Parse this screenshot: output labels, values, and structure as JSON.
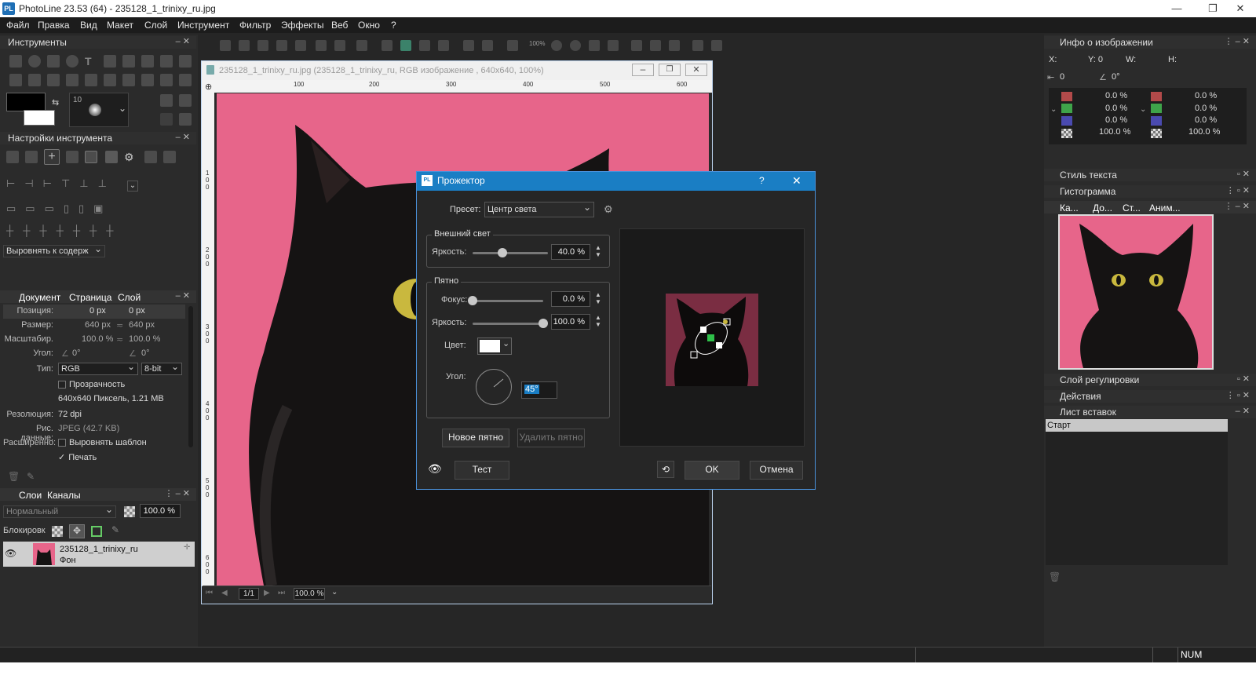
{
  "app": {
    "title": "PhotoLine 23.53 (64) - 235128_1_trinixy_ru.jpg",
    "icon_text": "PL"
  },
  "menu": [
    "Файл",
    "Правка",
    "Вид",
    "Макет",
    "Слой",
    "Инструмент",
    "Фильтр",
    "Эффекты",
    "Веб",
    "Окно",
    "?"
  ],
  "left": {
    "tools_title": "Инструменты",
    "brush_size": "10",
    "settings_title": "Настройки инструмента",
    "align_select": "Выровнять к содерж",
    "doc_tabs": [
      "Документ",
      "Страница",
      "Слой"
    ],
    "props": {
      "position_label": "Позиция:",
      "position_x": "0 px",
      "position_y": "0 px",
      "size_label": "Размер:",
      "size_w": "640 px",
      "size_h": "640 px",
      "scale_label": "Масштабир.",
      "scale_x": "100.0 %",
      "scale_y": "100.0 %",
      "angle_label": "Угол:",
      "angle_1": "0°",
      "angle_2": "0°",
      "type_label": "Тип:",
      "type_value": "RGB",
      "bit_value": "8-bit",
      "transparency": "Прозрачность",
      "pixels": "640x640 Пиксель, 1.21 MB",
      "res_label": "Резолюция:",
      "res_value": "72 dpi",
      "data_label": "Рис. данные:",
      "data_value": "JPEG (42.7 KB)",
      "ext_label": "Расширенно:",
      "ext_align": "Выровнять шаблон",
      "print": "Печать"
    },
    "layers_tabs": [
      "Слои",
      "Каналы"
    ],
    "blend_mode": "Нормальный",
    "opacity": "100.0 %",
    "lock_label": "Блокировк",
    "layer_name": "235128_1_trinixy_ru",
    "layer_sub": "Фон"
  },
  "document": {
    "title": "235128_1_trinixy_ru.jpg (235128_1_trinixy_ru, RGB изображение , 640x640, 100%)",
    "ruler_h": [
      "100",
      "200",
      "300",
      "400",
      "500",
      "600"
    ],
    "ruler_v": [
      "1\n0\n0",
      "2\n0\n0",
      "3\n0\n0",
      "4\n0\n0",
      "5\n0\n0",
      "6\n0\n0"
    ],
    "page": "1/1",
    "zoom": "100.0 %"
  },
  "right": {
    "info_title": "Инфо о изображении",
    "x_label": "X:",
    "y_label": "Y: 0",
    "w_label": "W:",
    "h_label": "H:",
    "dist": "0",
    "angle": "0°",
    "channels_left": [
      "0.0 %",
      "0.0 %",
      "0.0 %",
      "100.0 %"
    ],
    "channels_right": [
      "0.0 %",
      "0.0 %",
      "0.0 %",
      "100.0 %"
    ],
    "text_style": "Стиль текста",
    "histogram": "Гистограмма",
    "nav_tabs": [
      "Ка...",
      "До...",
      "Ст...",
      "Аним..."
    ],
    "adj_layer": "Слой регулировки",
    "actions": "Действия",
    "clip_sheet": "Лист вставок",
    "clip_item": "Старт"
  },
  "dialog": {
    "title": "Прожектор",
    "help": "?",
    "preset_label": "Пресет:",
    "preset_value": "Центр света",
    "outer_group": "Внешний свет",
    "brightness_label": "Яркость:",
    "outer_brightness": "40.0 %",
    "spot_group": "Пятно",
    "focus_label": "Фокус:",
    "focus_value": "0.0 %",
    "spot_brightness_label": "Яркость:",
    "spot_brightness": "100.0 %",
    "color_label": "Цвет:",
    "angle_label": "Угол:",
    "angle_value": "45°",
    "new_spot": "Новое пятно",
    "delete_spot": "Удалить пятно",
    "test": "Тест",
    "ok": "OK",
    "cancel": "Отмена",
    "outer_brightness_level": 0.4,
    "focus_level": 0.0,
    "spot_brightness_level": 1.0
  },
  "status": {
    "num": "NUM"
  },
  "colors": {
    "accent": "#1a7ec4",
    "canvas_bg": "#e7658a",
    "cat": "#141212",
    "eye": "#d4c24a"
  }
}
